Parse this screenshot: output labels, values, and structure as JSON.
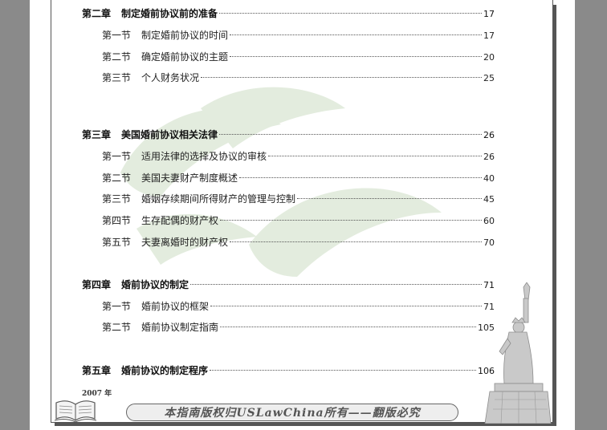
{
  "toc": [
    {
      "kind": "chapter",
      "label": "第二章",
      "title": "制定婚前协议前的准备",
      "page": "17"
    },
    {
      "kind": "section",
      "label": "第一节",
      "title": "制定婚前协议的时间",
      "page": "17"
    },
    {
      "kind": "section",
      "label": "第二节",
      "title": "确定婚前协议的主题",
      "page": "20"
    },
    {
      "kind": "section",
      "label": "第三节",
      "title": "个人财务状况",
      "page": "25"
    },
    {
      "kind": "chapter",
      "label": "第三章",
      "title": "美国婚前协议相关法律",
      "page": "26"
    },
    {
      "kind": "section",
      "label": "第一节",
      "title": "适用法律的选择及协议的审核",
      "page": "26"
    },
    {
      "kind": "section",
      "label": "第二节",
      "title": "美国夫妻财产制度概述",
      "page": "40"
    },
    {
      "kind": "section",
      "label": "第三节",
      "title": "婚姻存续期间所得财产的管理与控制",
      "page": "45"
    },
    {
      "kind": "section",
      "label": "第四节",
      "title": "生存配偶的财产权",
      "page": "60"
    },
    {
      "kind": "section",
      "label": "第五节",
      "title": "夫妻离婚时的财产权",
      "page": "70"
    },
    {
      "kind": "chapter",
      "label": "第四章",
      "title": "婚前协议的制定",
      "page": "71"
    },
    {
      "kind": "section",
      "label": "第一节",
      "title": "婚前协议的框架",
      "page": "71"
    },
    {
      "kind": "section",
      "label": "第二节",
      "title": "婚前协议制定指南",
      "page": "105"
    },
    {
      "kind": "chapter",
      "label": "第五章",
      "title": "婚前协议的制定程序",
      "page": "106"
    }
  ],
  "footer": {
    "year": "2007 年",
    "banner": "本指南版权归USLawChina所有——翻版必究"
  },
  "icons": [
    "open-book-icon",
    "statue-of-liberty-image",
    "leaf-watermark"
  ]
}
